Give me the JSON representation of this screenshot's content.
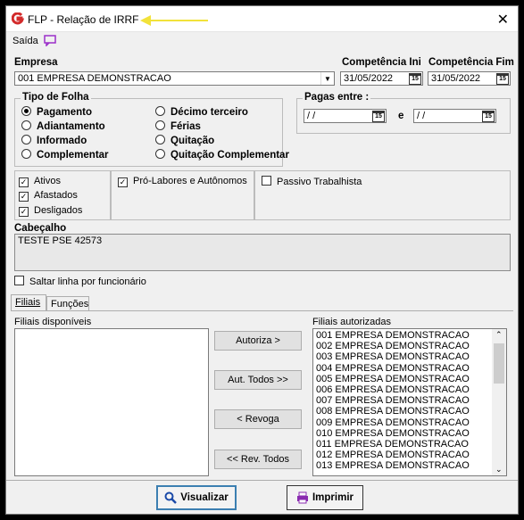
{
  "window": {
    "title": "FLP - Relação de IRRF"
  },
  "menu": {
    "saida": "Saída"
  },
  "empresa": {
    "label": "Empresa",
    "value": "001 EMPRESA DEMONSTRACAO"
  },
  "competencia": {
    "ini_label": "Competência Ini",
    "ini_value": "31/05/2022",
    "fim_label": "Competência Fim",
    "fim_value": "31/05/2022"
  },
  "tipo_folha": {
    "label": "Tipo de Folha",
    "options": [
      "Pagamento",
      "Adiantamento",
      "Informado",
      "Complementar",
      "Décimo terceiro",
      "Férias",
      "Quitação",
      "Quitação Complementar"
    ],
    "selected": "Pagamento"
  },
  "pagas_entre": {
    "label": "Pagas entre :",
    "from": "/ /",
    "to": "/ /",
    "and_label": "e"
  },
  "situacao": {
    "ativos": "Ativos",
    "afastados": "Afastados",
    "desligados": "Desligados",
    "pro_labores": "Pró-Labores e Autônomos",
    "passivo": "Passivo Trabalhista"
  },
  "cabecalho": {
    "label": "Cabeçalho",
    "value": "TESTE PSE 42573"
  },
  "saltar_linha": "Saltar linha por funcionário",
  "tabs": {
    "filiais": "Filiais",
    "funcoes": "Funções"
  },
  "filiais": {
    "disponiveis_label": "Filiais disponíveis",
    "autorizadas_label": "Filiais autorizadas",
    "autorizadas": [
      "001 EMPRESA DEMONSTRACAO",
      "002 EMPRESA DEMONSTRACAO",
      "003 EMPRESA DEMONSTRACAO",
      "004 EMPRESA DEMONSTRACAO",
      "005 EMPRESA DEMONSTRACAO",
      "006 EMPRESA DEMONSTRACAO",
      "007 EMPRESA DEMONSTRACAO",
      "008 EMPRESA DEMONSTRACAO",
      "009 EMPRESA DEMONSTRACAO",
      "010 EMPRESA DEMONSTRACAO",
      "011 EMPRESA DEMONSTRACAO",
      "012 EMPRESA DEMONSTRACAO",
      "013 EMPRESA DEMONSTRACAO"
    ]
  },
  "buttons": {
    "autoriza": "Autoriza >",
    "aut_todos": "Aut. Todos >>",
    "revoga": "< Revoga",
    "rev_todos": "<< Rev. Todos",
    "visualizar": "Visualizar",
    "imprimir": "Imprimir"
  },
  "calendar_glyph": "15"
}
